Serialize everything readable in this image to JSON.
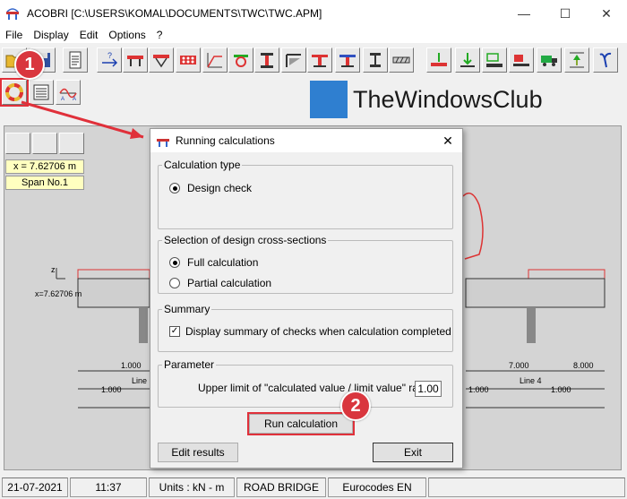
{
  "window": {
    "title": "ACOBRI [C:\\USERS\\KOMAL\\DOCUMENTS\\TWC\\TWC.APM]"
  },
  "menu": [
    "File",
    "Display",
    "Edit",
    "Options",
    "?"
  ],
  "watermark": {
    "text": "TheWindowsClub"
  },
  "position_panel": {
    "x_label": "x = 7.62706 m",
    "span_label": "Span No.1"
  },
  "drawing": {
    "axis_z": "z",
    "x_marker": "x=7.62706 m",
    "dims": [
      "1.000",
      "1.000",
      "Line",
      "7.000",
      "8.000",
      "Line 4",
      "1.000",
      "1.000"
    ]
  },
  "dialog": {
    "title": "Running calculations",
    "calc_type": {
      "label": "Calculation type",
      "option": "Design check"
    },
    "selection": {
      "label": "Selection of design cross-sections",
      "full": "Full calculation",
      "partial": "Partial calculation"
    },
    "summary": {
      "label": "Summary",
      "checkbox": "Display summary of checks when calculation completed"
    },
    "parameter": {
      "label": "Parameter",
      "text": "Upper limit of \"calculated value / limit value\" ratio =",
      "value": "1.00"
    },
    "run_button": "Run calculation",
    "edit_button": "Edit results",
    "exit_button": "Exit"
  },
  "status": {
    "date": "21-07-2021",
    "time": "11:37",
    "units": "Units : kN - m",
    "type": "ROAD BRIDGE",
    "code": "Eurocodes EN"
  },
  "badges": {
    "one": "1",
    "two": "2"
  },
  "colors": {
    "badge": "#d9363e",
    "highlight": "#e0303a",
    "canvas": "#d4d4d4"
  }
}
